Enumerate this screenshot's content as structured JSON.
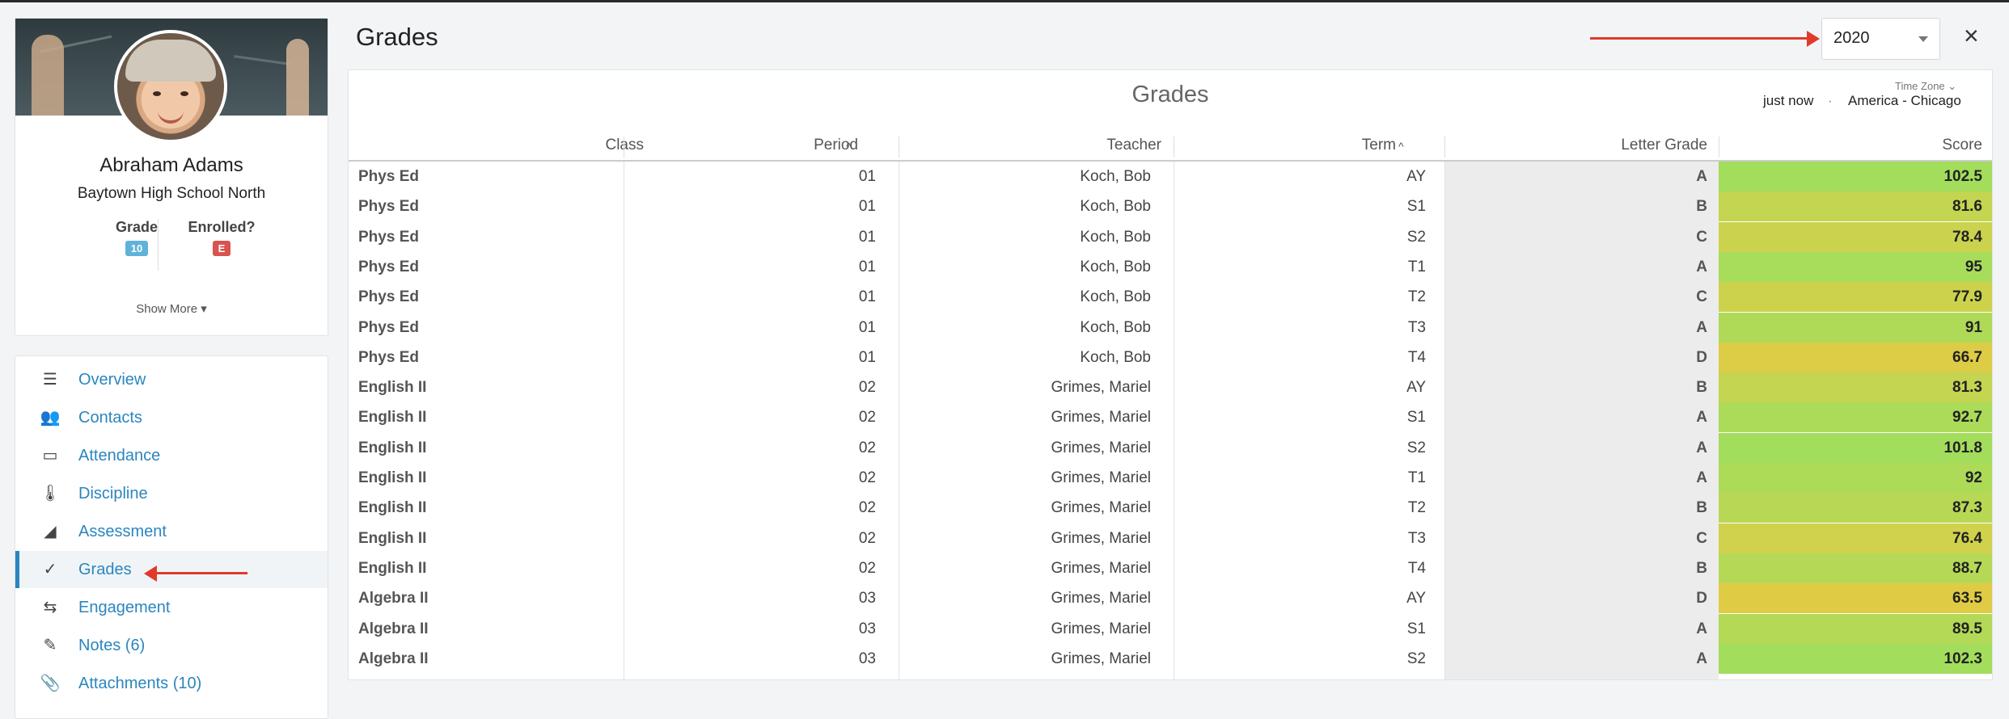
{
  "profile": {
    "name": "Abraham Adams",
    "school": "Baytown High School North",
    "grade_label": "Grade",
    "grade_value": "10",
    "enrolled_label": "Enrolled?",
    "enrolled_value": "E",
    "show_more": "Show More ▾",
    "colors": {
      "grade_badge": "#5fb3d9",
      "enrolled_badge": "#d9534f"
    }
  },
  "nav": {
    "items": [
      {
        "label": "Overview",
        "icon": "list-icon",
        "glyph": "☰"
      },
      {
        "label": "Contacts",
        "icon": "people-icon",
        "glyph": "👥"
      },
      {
        "label": "Attendance",
        "icon": "calendar-icon",
        "glyph": "▭"
      },
      {
        "label": "Discipline",
        "icon": "thermometer-icon",
        "glyph": "🌡"
      },
      {
        "label": "Assessment",
        "icon": "area-chart-icon",
        "glyph": "◢"
      },
      {
        "label": "Grades",
        "icon": "checkmark-icon",
        "glyph": "✓",
        "active": true
      },
      {
        "label": "Engagement",
        "icon": "exchange-icon",
        "glyph": "⇆"
      },
      {
        "label": "Notes (6)",
        "icon": "pencil-icon",
        "glyph": "✎"
      },
      {
        "label": "Attachments (10)",
        "icon": "paperclip-icon",
        "glyph": "📎"
      }
    ]
  },
  "header": {
    "title": "Grades",
    "year": "2020",
    "close": "×"
  },
  "panel": {
    "title": "Grades",
    "timezone_label": "Time Zone ⌄",
    "updated": "just now",
    "separator": "·",
    "timezone": "America - Chicago",
    "columns": [
      "Class",
      "Period",
      "Teacher",
      "Term",
      "Letter Grade",
      "Score"
    ],
    "sort_icon": "^",
    "rows": [
      {
        "class": "Phys Ed",
        "period": "01",
        "teacher": "Koch, Bob",
        "term": "AY",
        "letter": "A",
        "score": "102.5",
        "color": "#a3dd5c"
      },
      {
        "class": "Phys Ed",
        "period": "01",
        "teacher": "Koch, Bob",
        "term": "S1",
        "letter": "B",
        "score": "81.6",
        "color": "#c3d551"
      },
      {
        "class": "Phys Ed",
        "period": "01",
        "teacher": "Koch, Bob",
        "term": "S2",
        "letter": "C",
        "score": "78.4",
        "color": "#cbd34e"
      },
      {
        "class": "Phys Ed",
        "period": "01",
        "teacher": "Koch, Bob",
        "term": "T1",
        "letter": "A",
        "score": "95",
        "color": "#a8dc5b"
      },
      {
        "class": "Phys Ed",
        "period": "01",
        "teacher": "Koch, Bob",
        "term": "T2",
        "letter": "C",
        "score": "77.9",
        "color": "#cdd24d"
      },
      {
        "class": "Phys Ed",
        "period": "01",
        "teacher": "Koch, Bob",
        "term": "T3",
        "letter": "A",
        "score": "91",
        "color": "#afda58"
      },
      {
        "class": "Phys Ed",
        "period": "01",
        "teacher": "Koch, Bob",
        "term": "T4",
        "letter": "D",
        "score": "66.7",
        "color": "#ddcc46"
      },
      {
        "class": "English II",
        "period": "02",
        "teacher": "Grimes, Mariel",
        "term": "AY",
        "letter": "B",
        "score": "81.3",
        "color": "#c4d551"
      },
      {
        "class": "English II",
        "period": "02",
        "teacher": "Grimes, Mariel",
        "term": "S1",
        "letter": "A",
        "score": "92.7",
        "color": "#acdb59"
      },
      {
        "class": "English II",
        "period": "02",
        "teacher": "Grimes, Mariel",
        "term": "S2",
        "letter": "A",
        "score": "101.8",
        "color": "#a3dd5c"
      },
      {
        "class": "English II",
        "period": "02",
        "teacher": "Grimes, Mariel",
        "term": "T1",
        "letter": "A",
        "score": "92",
        "color": "#addb58"
      },
      {
        "class": "English II",
        "period": "02",
        "teacher": "Grimes, Mariel",
        "term": "T2",
        "letter": "B",
        "score": "87.3",
        "color": "#b8d855"
      },
      {
        "class": "English II",
        "period": "02",
        "teacher": "Grimes, Mariel",
        "term": "T3",
        "letter": "C",
        "score": "76.4",
        "color": "#d0d14c"
      },
      {
        "class": "English II",
        "period": "02",
        "teacher": "Grimes, Mariel",
        "term": "T4",
        "letter": "B",
        "score": "88.7",
        "color": "#b5d956"
      },
      {
        "class": "Algebra II",
        "period": "03",
        "teacher": "Grimes, Mariel",
        "term": "AY",
        "letter": "D",
        "score": "63.5",
        "color": "#e0cb45"
      },
      {
        "class": "Algebra II",
        "period": "03",
        "teacher": "Grimes, Mariel",
        "term": "S1",
        "letter": "A",
        "score": "89.5",
        "color": "#b3d957"
      },
      {
        "class": "Algebra II",
        "period": "03",
        "teacher": "Grimes, Mariel",
        "term": "S2",
        "letter": "A",
        "score": "102.3",
        "color": "#a3dd5c"
      }
    ]
  },
  "annotations": {
    "arrow_color": "#e03a2c"
  }
}
